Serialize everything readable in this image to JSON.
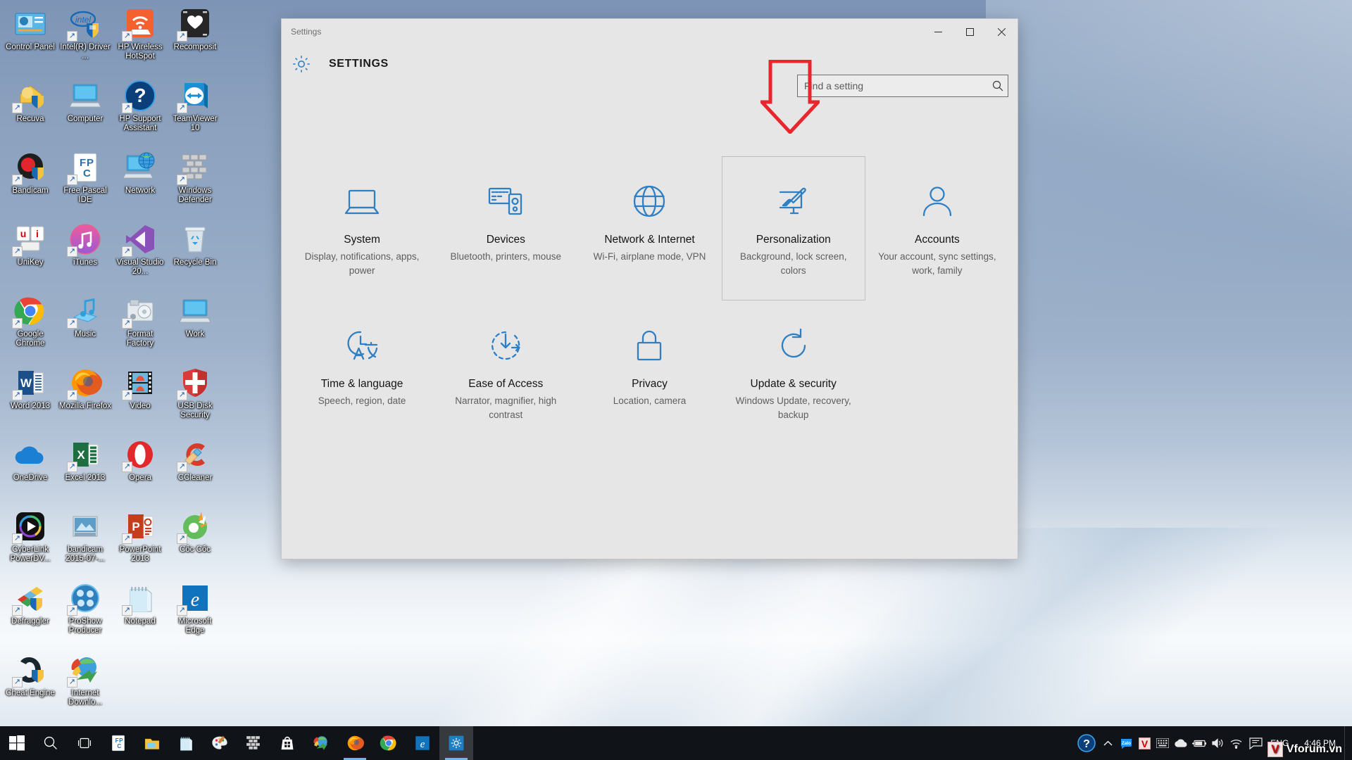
{
  "desktop": {
    "icons": [
      {
        "label": "Control Panel",
        "icon": "control-panel-icon",
        "shortcut": false
      },
      {
        "label": "Intel(R) Driver ...",
        "icon": "intel-driver-icon",
        "shortcut": true
      },
      {
        "label": "HP Wireless HotSpot",
        "icon": "hp-wireless-hotspot-icon",
        "shortcut": true
      },
      {
        "label": "Recomposit",
        "icon": "recomposit-icon",
        "shortcut": true
      },
      {
        "label": "Recuva",
        "icon": "recuva-icon",
        "shortcut": true
      },
      {
        "label": "Computer",
        "icon": "computer-icon",
        "shortcut": false
      },
      {
        "label": "HP Support Assistant",
        "icon": "hp-support-assistant-icon",
        "shortcut": true
      },
      {
        "label": "TeamViewer 10",
        "icon": "teamviewer-icon",
        "shortcut": true
      },
      {
        "label": "Bandicam",
        "icon": "bandicam-icon",
        "shortcut": true
      },
      {
        "label": "Free Pascal IDE",
        "icon": "free-pascal-icon",
        "shortcut": true
      },
      {
        "label": "Network",
        "icon": "network-icon",
        "shortcut": false
      },
      {
        "label": "Windows Defender",
        "icon": "windows-defender-icon",
        "shortcut": true
      },
      {
        "label": "UniKey",
        "icon": "unikey-icon",
        "shortcut": true
      },
      {
        "label": "iTunes",
        "icon": "itunes-icon",
        "shortcut": true
      },
      {
        "label": "Visual Studio 20...",
        "icon": "visual-studio-icon",
        "shortcut": true
      },
      {
        "label": "Recycle Bin",
        "icon": "recycle-bin-icon",
        "shortcut": false
      },
      {
        "label": "Google Chrome",
        "icon": "google-chrome-icon",
        "shortcut": true
      },
      {
        "label": "Music",
        "icon": "music-folder-icon",
        "shortcut": true
      },
      {
        "label": "Format Factory",
        "icon": "format-factory-icon",
        "shortcut": true
      },
      {
        "label": "Work",
        "icon": "work-folder-icon",
        "shortcut": false
      },
      {
        "label": "Word 2013",
        "icon": "word-icon",
        "shortcut": true
      },
      {
        "label": "Mozilla Firefox",
        "icon": "firefox-icon",
        "shortcut": true
      },
      {
        "label": "Video",
        "icon": "video-folder-icon",
        "shortcut": true
      },
      {
        "label": "USB Disk Security",
        "icon": "usb-disk-security-icon",
        "shortcut": true
      },
      {
        "label": "OneDrive",
        "icon": "onedrive-icon",
        "shortcut": false
      },
      {
        "label": "Excel 2013",
        "icon": "excel-icon",
        "shortcut": true
      },
      {
        "label": "Opera",
        "icon": "opera-icon",
        "shortcut": true
      },
      {
        "label": "CCleaner",
        "icon": "ccleaner-icon",
        "shortcut": true
      },
      {
        "label": "CyberLink PowerDV...",
        "icon": "cyberlink-powerdvd-icon",
        "shortcut": true
      },
      {
        "label": "bandicam 2015-07-...",
        "icon": "bandicam-video-icon",
        "shortcut": false
      },
      {
        "label": "PowerPoint 2013",
        "icon": "powerpoint-icon",
        "shortcut": true
      },
      {
        "label": "Cốc Cốc",
        "icon": "coccoc-icon",
        "shortcut": true
      },
      {
        "label": "Defraggler",
        "icon": "defraggler-icon",
        "shortcut": true
      },
      {
        "label": "ProShow Producer",
        "icon": "proshow-producer-icon",
        "shortcut": true
      },
      {
        "label": "Notepad",
        "icon": "notepad-icon",
        "shortcut": true
      },
      {
        "label": "Microsoft Edge",
        "icon": "microsoft-edge-icon",
        "shortcut": true
      },
      {
        "label": "Cheat Engine",
        "icon": "cheat-engine-icon",
        "shortcut": true
      },
      {
        "label": "Internet Downlo...",
        "icon": "internet-download-manager-icon",
        "shortcut": true
      }
    ]
  },
  "window": {
    "titlebar_text": "Settings",
    "minimize_label": "—",
    "maximize_label": "▢",
    "close_label": "✕",
    "header_title": "SETTINGS",
    "header_icon": "gear-icon"
  },
  "search": {
    "placeholder": "Find a setting",
    "value": "",
    "icon": "search-icon"
  },
  "tiles": [
    {
      "name": "System",
      "desc": "Display, notifications, apps, power",
      "icon": "laptop-icon",
      "selected": false
    },
    {
      "name": "Devices",
      "desc": "Bluetooth, printers, mouse",
      "icon": "devices-icon",
      "selected": false
    },
    {
      "name": "Network & Internet",
      "desc": "Wi-Fi, airplane mode, VPN",
      "icon": "globe-icon",
      "selected": false
    },
    {
      "name": "Personalization",
      "desc": "Background, lock screen, colors",
      "icon": "personalization-icon",
      "selected": true
    },
    {
      "name": "Accounts",
      "desc": "Your account, sync settings, work, family",
      "icon": "account-icon",
      "selected": false
    },
    {
      "name": "Time & language",
      "desc": "Speech, region, date",
      "icon": "time-language-icon",
      "selected": false
    },
    {
      "name": "Ease of Access",
      "desc": "Narrator, magnifier, high contrast",
      "icon": "ease-of-access-icon",
      "selected": false
    },
    {
      "name": "Privacy",
      "desc": "Location, camera",
      "icon": "lock-icon",
      "selected": false
    },
    {
      "name": "Update & security",
      "desc": "Windows Update, recovery, backup",
      "icon": "update-security-icon",
      "selected": false
    }
  ],
  "annotation": {
    "arrow_color": "#e8262d",
    "arrow_name": "red-down-arrow-pointing-to-search-box"
  },
  "taskbar": {
    "start_icon": "windows-start-icon",
    "items": [
      {
        "icon": "search-icon",
        "name": "taskbar-search",
        "running": false
      },
      {
        "icon": "task-view-icon",
        "name": "taskbar-task-view",
        "running": false
      },
      {
        "icon": "free-pascal-icon",
        "name": "taskbar-free-pascal",
        "running": false
      },
      {
        "icon": "file-explorer-icon",
        "name": "taskbar-file-explorer",
        "running": false
      },
      {
        "icon": "notepad-icon",
        "name": "taskbar-notepad",
        "running": false
      },
      {
        "icon": "paint-icon",
        "name": "taskbar-paint",
        "running": false
      },
      {
        "icon": "windows-defender-icon",
        "name": "taskbar-windows-defender",
        "running": false
      },
      {
        "icon": "store-icon",
        "name": "taskbar-store",
        "running": false
      },
      {
        "icon": "internet-download-manager-icon",
        "name": "taskbar-idm",
        "running": false
      },
      {
        "icon": "firefox-icon",
        "name": "taskbar-firefox",
        "running": true
      },
      {
        "icon": "google-chrome-icon",
        "name": "taskbar-chrome",
        "running": false
      },
      {
        "icon": "microsoft-edge-icon",
        "name": "taskbar-edge",
        "running": false
      },
      {
        "icon": "settings-gear-icon",
        "name": "taskbar-settings",
        "running": true
      }
    ],
    "tray": {
      "help_icon": "hp-support-assistant-icon",
      "chevron_icon": "chevron-up-icon",
      "icons": [
        "zalo-icon",
        "vcleaner-icon",
        "keyboard-icon",
        "onedrive-icon",
        "battery-icon",
        "volume-icon",
        "wifi-icon",
        "action-center-icon"
      ],
      "language": "ENG",
      "time": "4:46 PM",
      "date": ""
    }
  },
  "watermark": {
    "mark": "V",
    "text": "Vforum.vn"
  }
}
